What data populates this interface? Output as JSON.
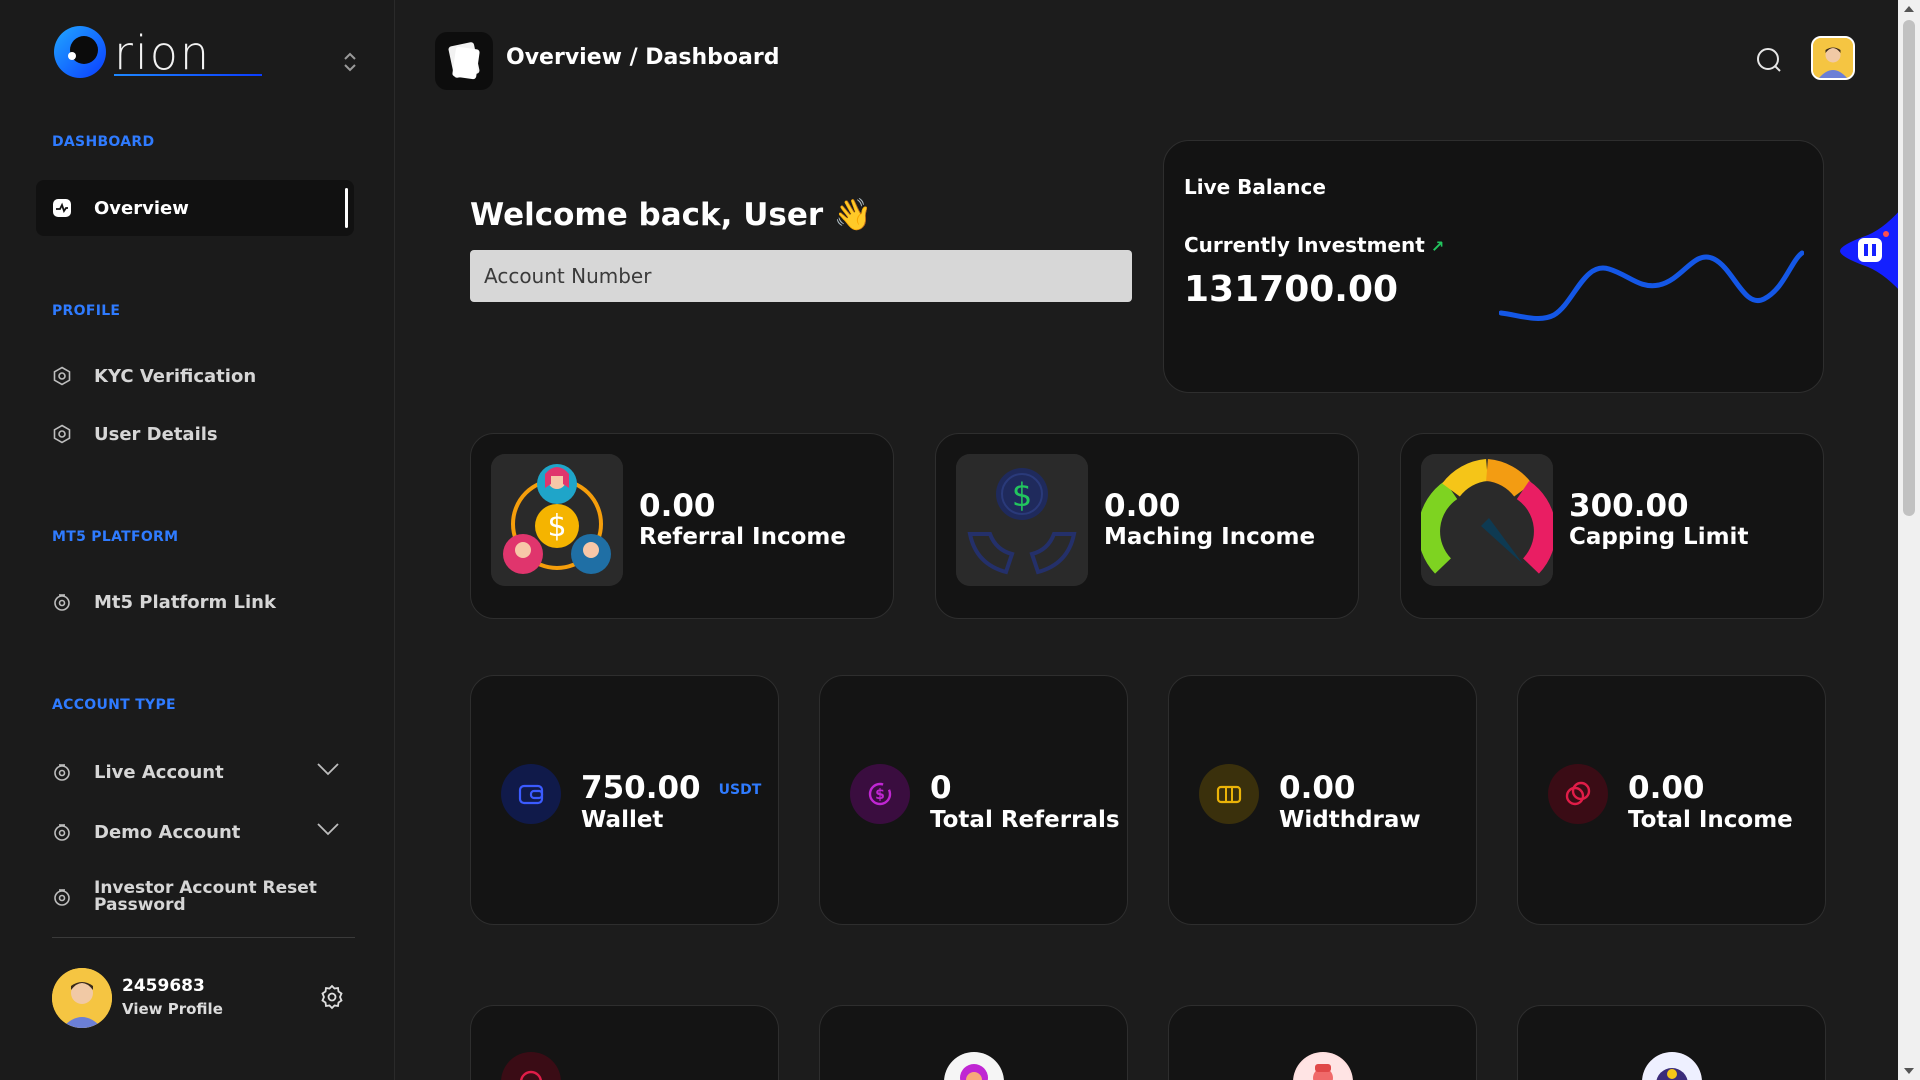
{
  "brand": {
    "name": "rion"
  },
  "sidebar": {
    "sections": {
      "dashboard": "DASHBOARD",
      "profile": "PROFILE",
      "mt5": "MT5 PLATFORM",
      "account_type": "ACCOUNT TYPE"
    },
    "items": {
      "overview": "Overview",
      "kyc": "KYC Verification",
      "user_details": "User Details",
      "mt5_link": "Mt5 Platform Link",
      "live_account": "Live Account",
      "demo_account": "Demo Account",
      "investor_reset_1": "Investor Account Reset",
      "investor_reset_2": "Password"
    },
    "profile": {
      "id": "2459683",
      "link": "View Profile"
    }
  },
  "header": {
    "breadcrumb": "Overview / Dashboard"
  },
  "main": {
    "welcome": "Welcome back, User 👋",
    "account_placeholder": "Account Number",
    "live_balance": {
      "title": "Live Balance",
      "subtitle": "Currently Investment",
      "arrow": "↗",
      "value": "131700.00",
      "accent": "#1457e6"
    },
    "income_cards": [
      {
        "value": "0.00",
        "label": "Referral Income"
      },
      {
        "value": "0.00",
        "label": "Maching Income"
      },
      {
        "value": "300.00",
        "label": "Capping Limit"
      }
    ],
    "stat_cards": [
      {
        "value": "750.00",
        "unit": "USDT",
        "label": "Wallet",
        "icon": "wallet-icon",
        "color": "#3b5bff"
      },
      {
        "value": "0",
        "label": "Total Referrals",
        "icon": "dollar-refresh-icon",
        "color": "#c026d3"
      },
      {
        "value": "0.00",
        "label": "Widthdraw",
        "icon": "ticket-icon",
        "color": "#eab308"
      },
      {
        "value": "0.00",
        "label": "Total Income",
        "icon": "coins-icon",
        "color": "#e11d48"
      }
    ]
  }
}
